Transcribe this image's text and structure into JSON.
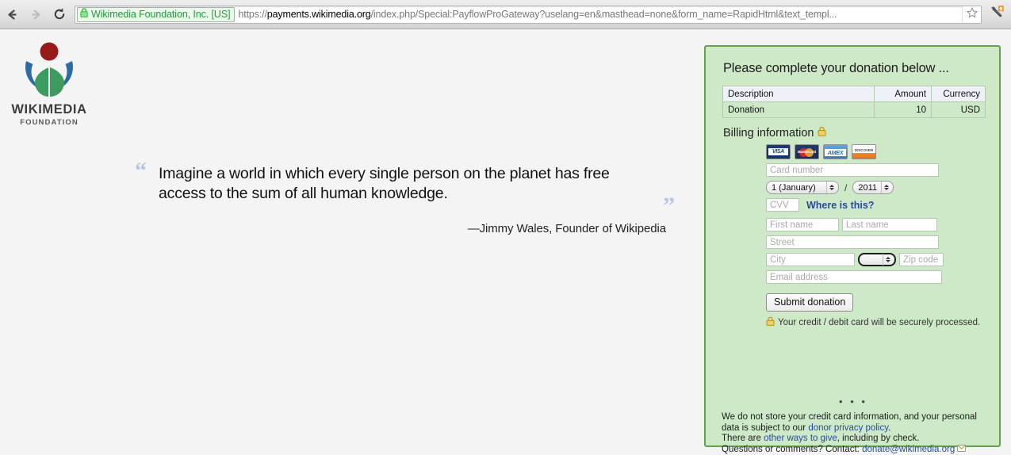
{
  "browser": {
    "back_icon": "back-arrow-icon",
    "forward_icon": "forward-arrow-icon",
    "reload_icon": "reload-icon",
    "ev_certificate_label": "Wikimedia Foundation, Inc. [US]",
    "lock_icon": "padlock-icon",
    "url_scheme": "https://",
    "url_host": "payments.wikimedia.org",
    "url_path": "/index.php/Special:PayflowProGateway?uselang=en&masthead=none&form_name=RapidHtml&text_templ...",
    "url_full": "https://payments.wikimedia.org/index.php/Special:PayflowProGateway?uselang=en&masthead=none&form_name=RapidHtml&text_templ...",
    "star_icon": "bookmark-star-icon",
    "wrench_icon": "wrench-menu-icon",
    "wrench_badge": "update-available-badge"
  },
  "logo": {
    "icon": "wikimedia-foundation-logo",
    "wordmark": "WIKIMEDIA",
    "wordmark_sub": "FOUNDATION",
    "colors": {
      "ring": "#2d6ca2",
      "leaf": "#3e9b5f",
      "dot": "#991a1a"
    }
  },
  "quote": {
    "open_mark": "“",
    "close_mark": "”",
    "text": "Imagine a world in which every single person on the planet has free access to the sum of all human knowledge.",
    "attribution": "—Jimmy Wales, Founder of Wikipedia"
  },
  "panel": {
    "heading": "Please complete your donation below ...",
    "background_color": "#cee9c8",
    "border_color": "#62a24c",
    "amount_table": {
      "headers": [
        "Description",
        "Amount",
        "Currency"
      ],
      "rows": [
        [
          "Donation",
          "10",
          "USD"
        ]
      ]
    },
    "billing": {
      "heading": "Billing information",
      "lock_icon": "gold-padlock-icon",
      "card_logos": [
        {
          "name": "visa-card-logo",
          "label": "VISA"
        },
        {
          "name": "mastercard-card-logo",
          "label": "MasterCard"
        },
        {
          "name": "amex-card-logo",
          "label": "AMEX"
        },
        {
          "name": "discover-card-logo",
          "label": "DISCOVER"
        }
      ],
      "card_number_placeholder": "Card number",
      "exp_month_value": "1 (January)",
      "exp_separator": "/",
      "exp_year_value": "2011",
      "cvv_placeholder": "CVV",
      "cvv_help_link": "Where is this?",
      "first_name_placeholder": "First name",
      "last_name_placeholder": "Last name",
      "street_placeholder": "Street",
      "city_placeholder": "City",
      "state_value": "",
      "zip_placeholder": "Zip code",
      "email_placeholder": "Email address"
    },
    "submit_label": "Submit donation",
    "secure_note": "Your credit / debit card will be securely processed.",
    "secure_note_icon": "gold-padlock-icon",
    "footer": {
      "dots": "• • •",
      "line1_a": "We do not store your credit card information, and your personal data is subject to our ",
      "line1_link": "donor privacy policy",
      "line1_b": ".",
      "line2_a": "There are ",
      "line2_link": "other ways to give",
      "line2_b": ", including by check.",
      "line3_a": "Questions or comments? Contact: ",
      "line3_link": "donate@wikimedia.org",
      "mail_icon": "envelope-icon"
    }
  }
}
